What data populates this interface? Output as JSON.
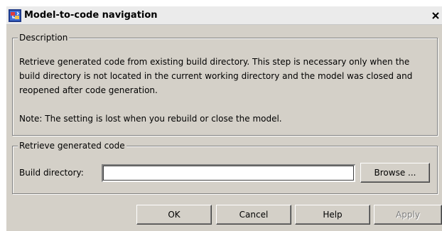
{
  "window": {
    "title": "Model-to-code navigation",
    "close_glyph": "✕"
  },
  "description": {
    "legend": "Description",
    "body": "Retrieve generated code from existing build directory. This step is necessary only when the build directory is not located in the current working directory and the model was closed and reopened after code generation.",
    "note": "Note: The setting is lost when you rebuild or close the model."
  },
  "retrieve": {
    "legend": "Retrieve generated code",
    "build_label": "Build directory:",
    "build_value": "",
    "browse_label": "Browse ..."
  },
  "buttons": {
    "ok": "OK",
    "cancel": "Cancel",
    "help": "Help",
    "apply": "Apply"
  },
  "colors": {
    "dialog_bg": "#d4d0c8",
    "titlebar_bg": "#ebebeb",
    "disabled_text": "#808080"
  },
  "icons": {
    "app": "simulink-model-icon",
    "close": "close-icon"
  },
  "states": {
    "apply_enabled": false
  }
}
